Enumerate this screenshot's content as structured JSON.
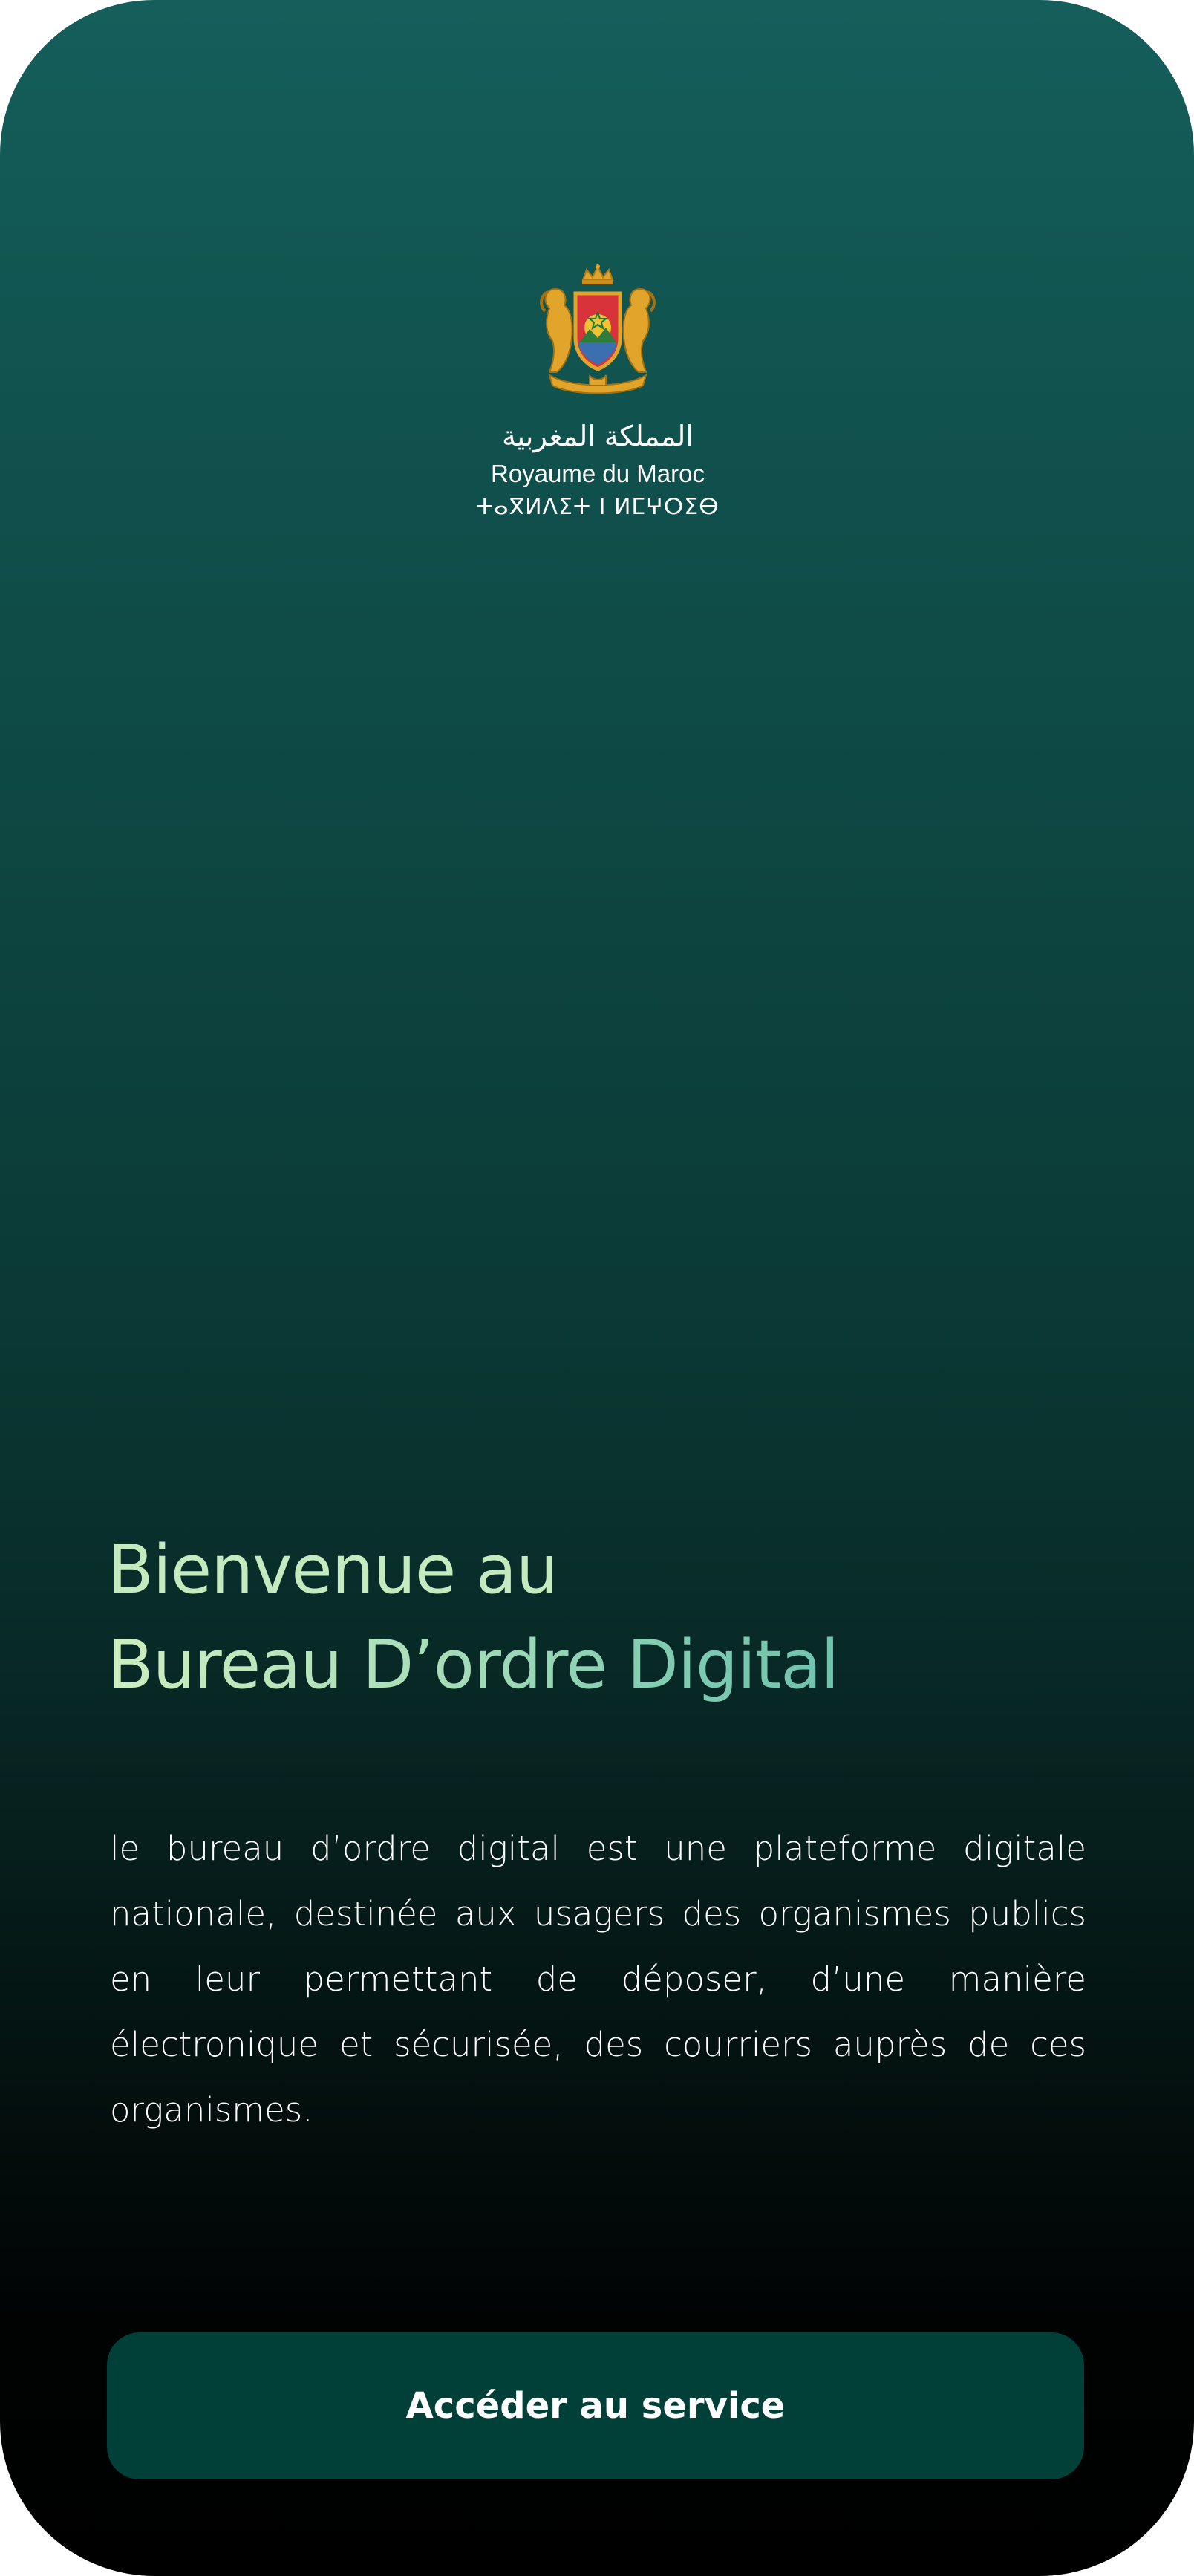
{
  "logo": {
    "emblem_icon": "moroccan-coat-of-arms-icon",
    "arabic": "المملكة المغربية",
    "latin": "Royaume du Maroc",
    "tifinagh": "ⵜⴰⴳⵍⴷⵉⵜ ⵏ ⵍⵎⵖⵔⵉⴱ"
  },
  "headline": {
    "line1": "Bienvenue au",
    "line2": "Bureau D’ordre Digital"
  },
  "description": "le bureau d’ordre digital est une plateforme digitale nationale, destinée aux usagers des organismes publics en leur permettant de déposer, d’une manière électronique et sécurisée, des courriers auprès de ces organismes.",
  "cta": {
    "label": "Accéder au service"
  },
  "colors": {
    "gradient_top": "#155e5b",
    "gradient_bottom": "#000000",
    "headline_line1": "#c4ebbf",
    "headline_line2_end": "#5bb8a8",
    "button_bg": "#004038",
    "emblem_gold": "#e0a52a"
  }
}
